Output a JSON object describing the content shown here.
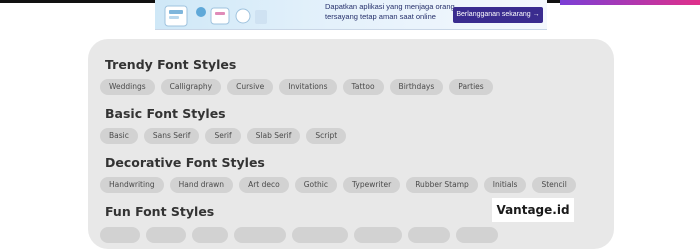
{
  "ad": {
    "line1": "Dapatkan aplikasi yang menjaga orang",
    "line2": "tersayang tetap aman saat online",
    "cta": "Berlangganan sekarang →"
  },
  "sections": [
    {
      "title": "Trendy Font Styles",
      "tags": [
        "Weddings",
        "Calligraphy",
        "Cursive",
        "Invitations",
        "Tattoo",
        "Birthdays",
        "Parties"
      ]
    },
    {
      "title": "Basic Font Styles",
      "tags": [
        "Basic",
        "Sans Serif",
        "Serif",
        "Slab Serif",
        "Script"
      ]
    },
    {
      "title": "Decorative Font Styles",
      "tags": [
        "Handwriting",
        "Hand drawn",
        "Art deco",
        "Gothic",
        "Typewriter",
        "Rubber Stamp",
        "Initials",
        "Stencil"
      ]
    },
    {
      "title": "Fun Font Styles",
      "tags": []
    }
  ],
  "watermark": "Vantage.id",
  "colors": {
    "card_bg": "#e8e8e8",
    "tag_bg": "#d2d2d2",
    "title_text": "#333333",
    "ad_cta_bg": "#3a2c8f",
    "accent_gradient_start": "#7b3fd6",
    "accent_gradient_end": "#e0308a"
  }
}
